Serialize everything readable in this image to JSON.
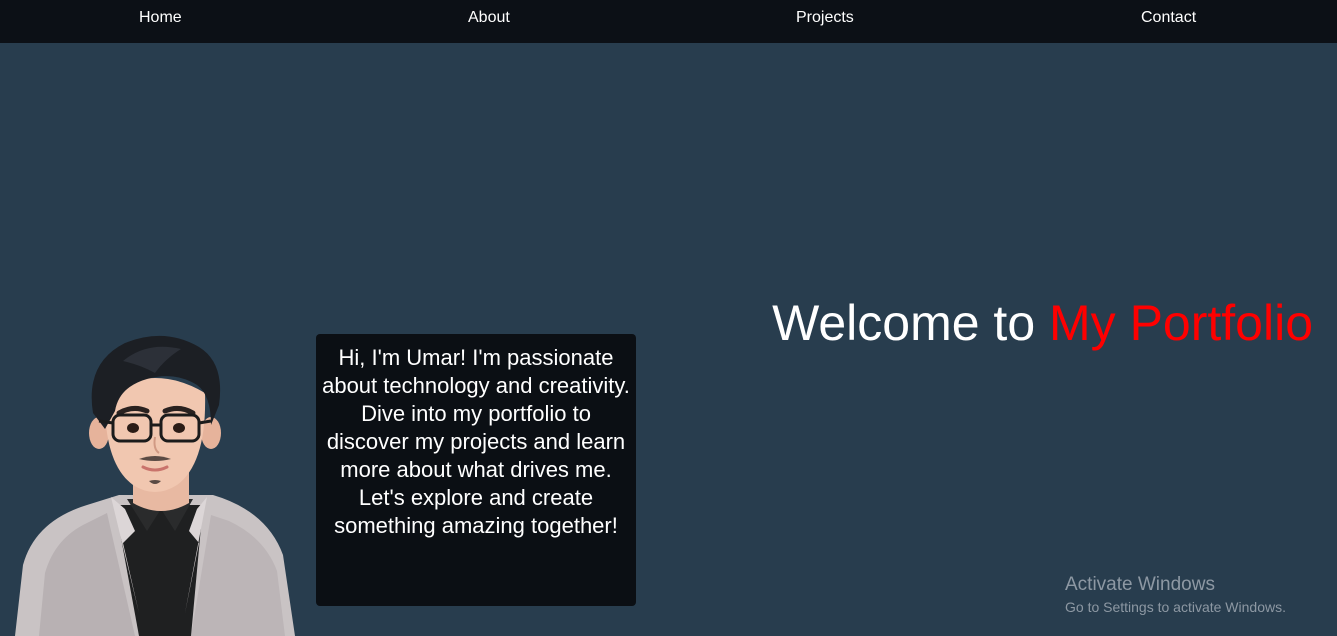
{
  "nav": {
    "items": [
      {
        "label": "Home"
      },
      {
        "label": "About"
      },
      {
        "label": "Projects"
      },
      {
        "label": "Contact"
      }
    ]
  },
  "hero": {
    "title_prefix": "Welcome to",
    "title_accent": "My Portfolio",
    "intro": "Hi, I'm Umar! I'm passionate about technology and creativity. Dive into my portfolio to discover my projects and learn more about what drives me. Let's explore and create something amazing together!"
  },
  "system_watermark": {
    "line1": "Activate Windows",
    "line2": "Go to Settings to activate Windows."
  },
  "colors": {
    "page_bg": "#283d4e",
    "nav_bg": "#0c1016",
    "accent": "#ff0000",
    "speech_bg": "#0b0f14"
  },
  "icons": {
    "avatar": "cartoon-person-avatar"
  }
}
